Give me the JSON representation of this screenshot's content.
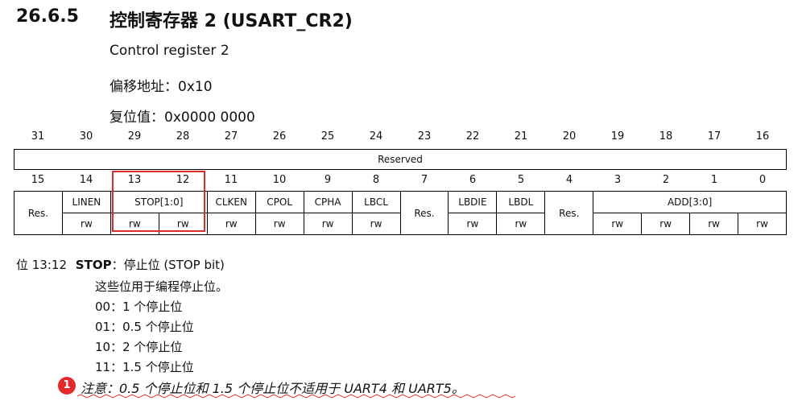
{
  "section": {
    "number": "26.6.5",
    "title": "控制寄存器 2 (USART_CR2)",
    "subtitle": "Control register 2",
    "offset": "偏移地址：0x10",
    "reset": "复位值：0x0000 0000"
  },
  "register": {
    "upper_bits": [
      "31",
      "30",
      "29",
      "28",
      "27",
      "26",
      "25",
      "24",
      "23",
      "22",
      "21",
      "20",
      "19",
      "18",
      "17",
      "16"
    ],
    "upper_reserved": "Reserved",
    "lower_bits": [
      "15",
      "14",
      "13",
      "12",
      "11",
      "10",
      "9",
      "8",
      "7",
      "6",
      "5",
      "4",
      "3",
      "2",
      "1",
      "0"
    ],
    "fields": [
      {
        "label": "Res.",
        "span": 1
      },
      {
        "label": "LINEN",
        "span": 1
      },
      {
        "label": "STOP[1:0]",
        "span": 2
      },
      {
        "label": "CLKEN",
        "span": 1
      },
      {
        "label": "CPOL",
        "span": 1
      },
      {
        "label": "CPHA",
        "span": 1
      },
      {
        "label": "LBCL",
        "span": 1
      },
      {
        "label": "Res.",
        "span": 1
      },
      {
        "label": "LBDIE",
        "span": 1
      },
      {
        "label": "LBDL",
        "span": 1
      },
      {
        "label": "Res.",
        "span": 1
      },
      {
        "label": "ADD[3:0]",
        "span": 4
      }
    ],
    "access": [
      "",
      "rw",
      "rw",
      "rw",
      "rw",
      "rw",
      "rw",
      "rw",
      "",
      "rw",
      "rw",
      "rw",
      "rw",
      "rw",
      "rw",
      "rw"
    ]
  },
  "description": {
    "heading_prefix": "位 13:12",
    "heading_field": "STOP",
    "heading_suffix": "：停止位 (STOP bit)",
    "intro": "这些位用于编程停止位。",
    "options": [
      "00：1 个停止位",
      "01：0.5 个停止位",
      "10：2 个停止位",
      "11：1.5 个停止位"
    ]
  },
  "note": {
    "badge": "1",
    "text": "注意：0.5 个停止位和 1.5 个停止位不适用于 UART4 和 UART5。",
    "badge_color": "#e32a2a"
  },
  "colors": {
    "highlight": "#e02b2b"
  }
}
